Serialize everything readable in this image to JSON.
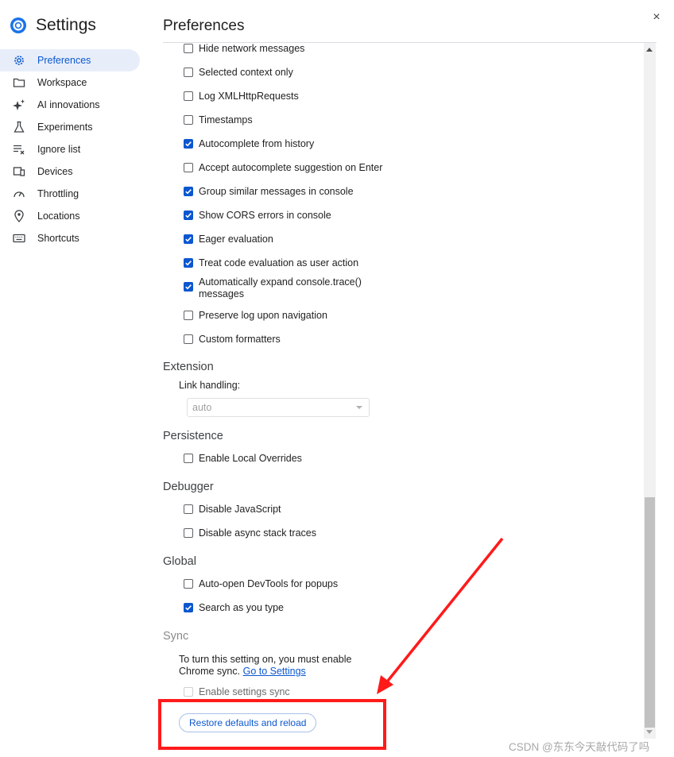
{
  "app": {
    "title": "Settings",
    "page_title": "Preferences",
    "close_label": "×"
  },
  "sidebar": {
    "items": [
      {
        "label": "Preferences",
        "icon": "gear-icon",
        "active": true
      },
      {
        "label": "Workspace",
        "icon": "folder-icon",
        "active": false
      },
      {
        "label": "AI innovations",
        "icon": "sparkle-icon",
        "active": false
      },
      {
        "label": "Experiments",
        "icon": "flask-icon",
        "active": false
      },
      {
        "label": "Ignore list",
        "icon": "ignore-list-icon",
        "active": false
      },
      {
        "label": "Devices",
        "icon": "devices-icon",
        "active": false
      },
      {
        "label": "Throttling",
        "icon": "gauge-icon",
        "active": false
      },
      {
        "label": "Locations",
        "icon": "location-pin-icon",
        "active": false
      },
      {
        "label": "Shortcuts",
        "icon": "keyboard-icon",
        "active": false
      }
    ]
  },
  "console_options": [
    {
      "label": "Hide network messages",
      "checked": false
    },
    {
      "label": "Selected context only",
      "checked": false
    },
    {
      "label": "Log XMLHttpRequests",
      "checked": false
    },
    {
      "label": "Timestamps",
      "checked": false
    },
    {
      "label": "Autocomplete from history",
      "checked": true
    },
    {
      "label": "Accept autocomplete suggestion on Enter",
      "checked": false
    },
    {
      "label": "Group similar messages in console",
      "checked": true
    },
    {
      "label": "Show CORS errors in console",
      "checked": true
    },
    {
      "label": "Eager evaluation",
      "checked": true
    },
    {
      "label": "Treat code evaluation as user action",
      "checked": true
    },
    {
      "label_line1": "Automatically expand console.trace()",
      "label_line2": "messages",
      "checked": true
    },
    {
      "label": "Preserve log upon navigation",
      "checked": false
    },
    {
      "label": "Custom formatters",
      "checked": false
    }
  ],
  "extension": {
    "title": "Extension",
    "link_handling_label": "Link handling:",
    "link_handling_value": "auto"
  },
  "persistence": {
    "title": "Persistence",
    "options": [
      {
        "label": "Enable Local Overrides",
        "checked": false
      }
    ]
  },
  "debugger": {
    "title": "Debugger",
    "options": [
      {
        "label": "Disable JavaScript",
        "checked": false
      },
      {
        "label": "Disable async stack traces",
        "checked": false
      }
    ]
  },
  "global": {
    "title": "Global",
    "options": [
      {
        "label": "Auto-open DevTools for popups",
        "checked": false
      },
      {
        "label": "Search as you type",
        "checked": true
      }
    ]
  },
  "sync": {
    "title": "Sync",
    "text_line1": "To turn this setting on, you must enable",
    "text_line2": "Chrome sync.",
    "link_label": "Go to Settings",
    "option_label": "Enable settings sync",
    "option_checked": false
  },
  "restore_label": "Restore defaults and reload",
  "watermark": "CSDN @东东今天敲代码了吗",
  "colors": {
    "accent": "#0b57d0",
    "active_bg": "#e8eef9",
    "annotation": "#ff1a1a"
  }
}
